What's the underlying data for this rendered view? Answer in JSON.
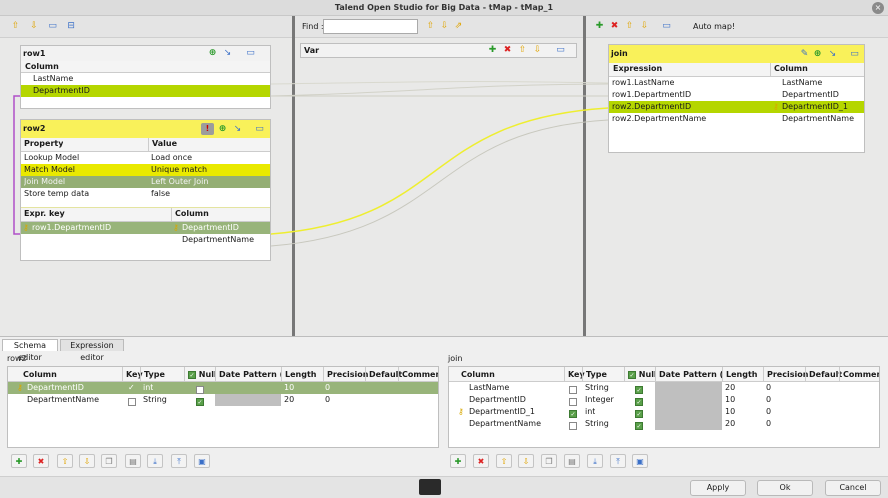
{
  "window": {
    "title": "Talend Open Studio for Big Data - tMap - tMap_1",
    "close": "×"
  },
  "find": {
    "label": "Find :",
    "value": ""
  },
  "var": {
    "title": "Var"
  },
  "automap": "Auto map!",
  "row1": {
    "title": "row1",
    "column_header": "Column",
    "columns": [
      "LastName",
      "DepartmentID"
    ]
  },
  "row2": {
    "title": "row2",
    "prop_headers": [
      "Property",
      "Value"
    ],
    "props": [
      {
        "k": "Lookup Model",
        "v": "Load once"
      },
      {
        "k": "Match Model",
        "v": "Unique match"
      },
      {
        "k": "Join Model",
        "v": "Left Outer Join"
      },
      {
        "k": "Store temp data",
        "v": "false"
      }
    ],
    "expr_headers": [
      "Expr. key",
      "Column"
    ],
    "expr_rows": [
      {
        "e": "row1.DepartmentID",
        "c": "DepartmentID"
      },
      {
        "e": "",
        "c": "DepartmentName"
      }
    ]
  },
  "join": {
    "title": "join",
    "headers": [
      "Expression",
      "Column"
    ],
    "rows": [
      {
        "e": "row1.LastName",
        "c": "LastName"
      },
      {
        "e": "row1.DepartmentID",
        "c": "DepartmentID"
      },
      {
        "e": "row2.DepartmentID",
        "c": "DepartmentID_1"
      },
      {
        "e": "row2.DepartmentName",
        "c": "DepartmentName"
      }
    ]
  },
  "tabs": [
    "Schema editor",
    "Expression editor"
  ],
  "schema_left": {
    "title": "row2",
    "headers": [
      "Column",
      "Key",
      "Type",
      "Nulla",
      "Date Pattern (Ctr",
      "Length",
      "Precision",
      "Default",
      "Comment"
    ],
    "rows": [
      {
        "c": "DepartmentID",
        "type": "int",
        "len": "10",
        "prec": "0"
      },
      {
        "c": "DepartmentName",
        "type": "String",
        "len": "20",
        "prec": "0"
      }
    ]
  },
  "schema_right": {
    "title": "join",
    "headers": [
      "Column",
      "Key",
      "Type",
      "Nulla",
      "Date Pattern (Ctr",
      "Length",
      "Precision",
      "Default",
      "Comment"
    ],
    "rows": [
      {
        "c": "LastName",
        "type": "String",
        "len": "20",
        "prec": "0"
      },
      {
        "c": "DepartmentID",
        "type": "Integer",
        "len": "10",
        "prec": "0"
      },
      {
        "c": "DepartmentID_1",
        "type": "int",
        "len": "10",
        "prec": "0"
      },
      {
        "c": "DepartmentName",
        "type": "String",
        "len": "20",
        "prec": "0"
      }
    ]
  },
  "buttons": {
    "apply": "Apply",
    "ok": "Ok",
    "cancel": "Cancel"
  },
  "colors": {
    "yellow_header": "#f9f15a",
    "selected_green": "#b5d600",
    "link_yellow": "#eeee30"
  }
}
